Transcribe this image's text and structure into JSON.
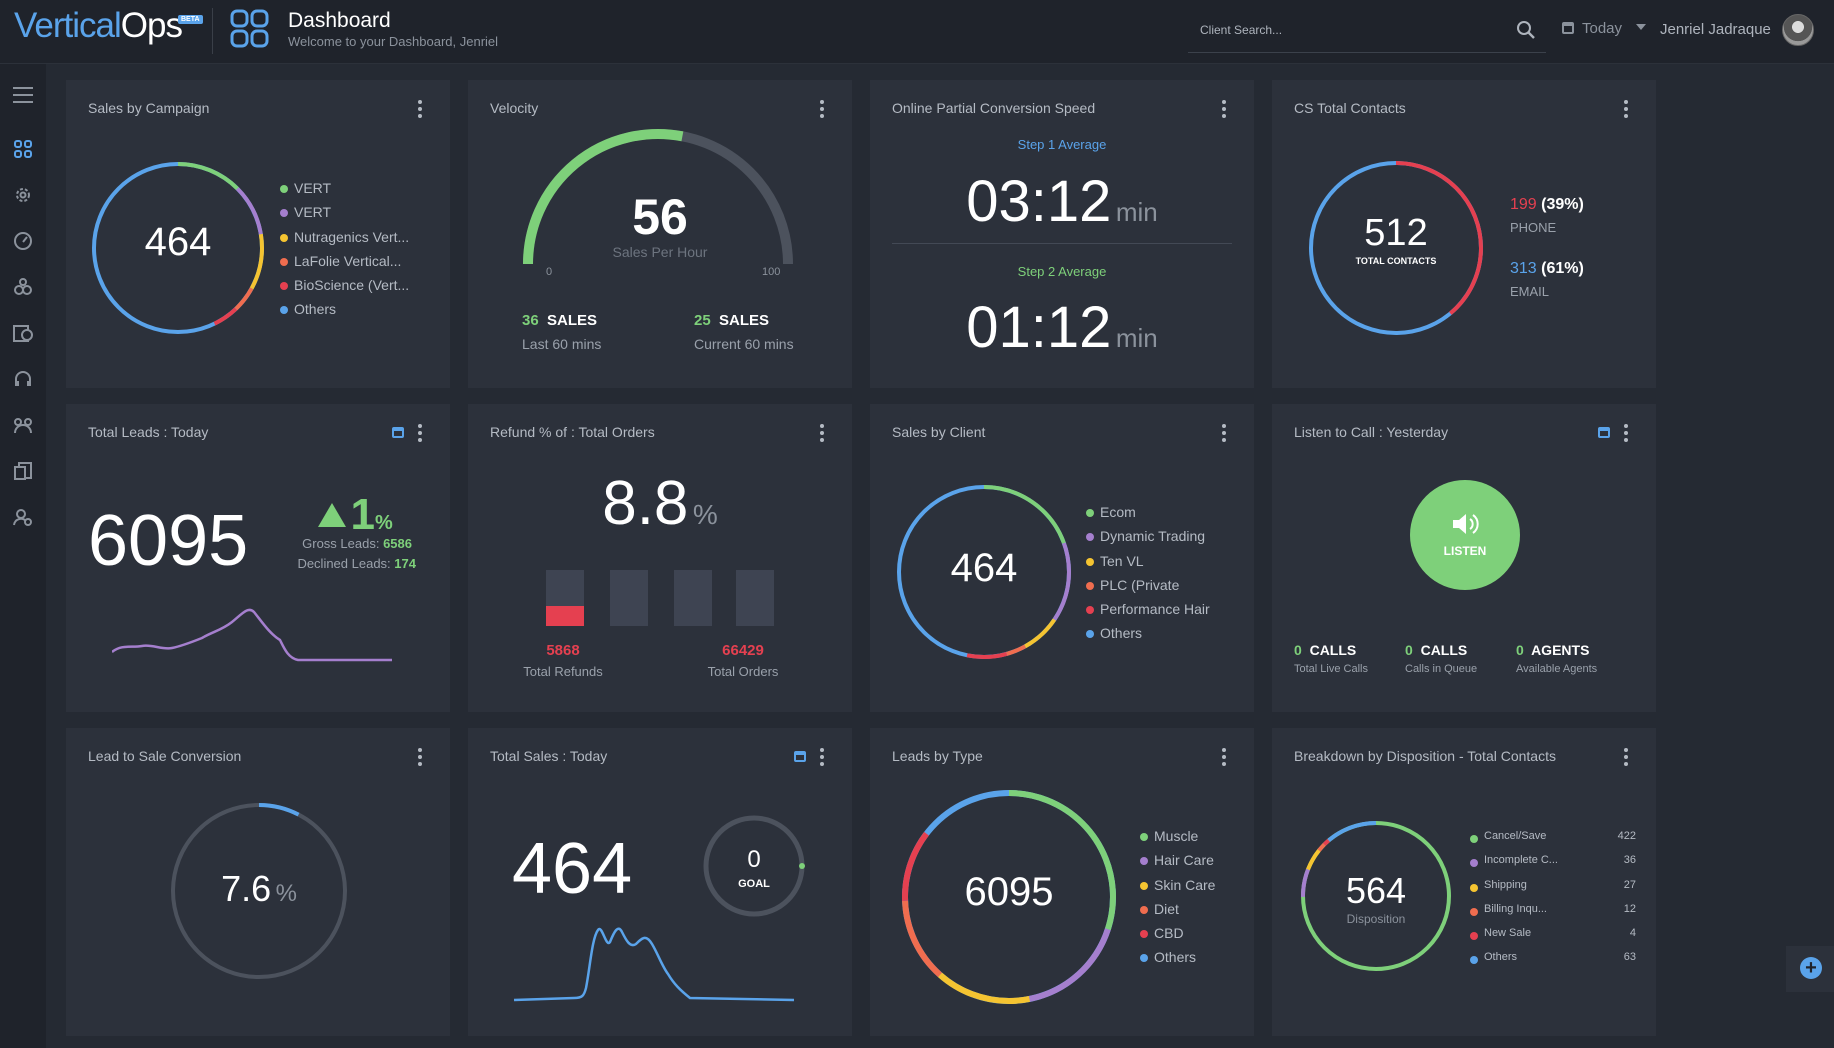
{
  "header": {
    "logo_text_a": "Vertical",
    "logo_text_b": "Ops",
    "beta": "BETA",
    "title": "Dashboard",
    "subtitle": "Welcome to your Dashboard, Jenriel",
    "search_placeholder": "Client Search...",
    "date_label": "Today",
    "user_name": "Jenriel Jadraque"
  },
  "colors": {
    "green": "#7ed07a",
    "blue": "#5aa3ea",
    "red": "#e54050",
    "purple": "#a57fce",
    "yellow": "#f5c431",
    "orange": "#f06d4f",
    "gray": "#4c525d"
  },
  "sidebar": {
    "items": [
      "menu-icon",
      "dashboard-icon",
      "gear-icon",
      "gauge-icon",
      "settings-cluster-icon",
      "dollar-doc-icon",
      "headset-icon",
      "team-icon",
      "documents-icon",
      "user-settings-icon"
    ]
  },
  "cards": {
    "sales_by_campaign": {
      "title": "Sales by Campaign",
      "total": "464",
      "legend": [
        {
          "label": "VERT",
          "color": "#7ed07a"
        },
        {
          "label": "VERT",
          "color": "#a57fce"
        },
        {
          "label": "Nutragenics Vert...",
          "color": "#f5c431"
        },
        {
          "label": "LaFolie Vertical...",
          "color": "#f06d4f"
        },
        {
          "label": "BioScience (Vert...",
          "color": "#e54050"
        },
        {
          "label": "Others",
          "color": "#5aa3ea"
        }
      ]
    },
    "velocity": {
      "title": "Velocity",
      "value": "56",
      "value_label": "Sales Per Hour",
      "min": "0",
      "max": "100",
      "gauge_fraction": 0.56,
      "left_num": "36",
      "left_unit": "SALES",
      "left_label": "Last 60 mins",
      "right_num": "25",
      "right_unit": "SALES",
      "right_label": "Current 60 mins"
    },
    "conversion_speed": {
      "title": "Online Partial Conversion Speed",
      "step1_label": "Step 1 Average",
      "step1_value": "03:12",
      "step1_unit": "min",
      "step2_label": "Step 2 Average",
      "step2_value": "01:12",
      "step2_unit": "min"
    },
    "cs_total_contacts": {
      "title": "CS Total Contacts",
      "total": "512",
      "total_label": "TOTAL CONTACTS",
      "phone_num": "199",
      "phone_pct": "(39%)",
      "phone_label": "PHONE",
      "email_num": "313",
      "email_pct": "(61%)",
      "email_label": "EMAIL"
    },
    "total_leads": {
      "title": "Total Leads : Today",
      "value": "6095",
      "change": "1",
      "change_unit": "%",
      "gross_label": "Gross Leads:",
      "gross_value": "6586",
      "declined_label": "Declined Leads:",
      "declined_value": "174"
    },
    "refund": {
      "title": "Refund % of : Total Orders",
      "value": "8.8",
      "unit": "%",
      "refunds_num": "5868",
      "refunds_label": "Total Refunds",
      "orders_num": "66429",
      "orders_label": "Total Orders"
    },
    "sales_by_client": {
      "title": "Sales by Client",
      "total": "464",
      "legend": [
        {
          "label": "Ecom",
          "color": "#7ed07a"
        },
        {
          "label": "Dynamic Trading",
          "color": "#a57fce"
        },
        {
          "label": "Ten VL",
          "color": "#f5c431"
        },
        {
          "label": "PLC (Private",
          "color": "#f06d4f"
        },
        {
          "label": "Performance Hair",
          "color": "#e54050"
        },
        {
          "label": "Others",
          "color": "#5aa3ea"
        }
      ]
    },
    "listen_to_call": {
      "title": "Listen to Call : Yesterday",
      "button_label": "LISTEN",
      "stats": [
        {
          "num": "0",
          "unit": "CALLS",
          "label": "Total Live Calls"
        },
        {
          "num": "0",
          "unit": "CALLS",
          "label": "Calls in Queue"
        },
        {
          "num": "0",
          "unit": "AGENTS",
          "label": "Available Agents"
        }
      ]
    },
    "lead_to_sale": {
      "title": "Lead to Sale Conversion",
      "value": "7.6",
      "unit": "%",
      "fraction": 0.076
    },
    "total_sales": {
      "title": "Total Sales : Today",
      "value": "464",
      "goal_num": "0",
      "goal_label": "GOAL"
    },
    "leads_by_type": {
      "title": "Leads by Type",
      "total": "6095",
      "legend": [
        {
          "label": "Muscle",
          "color": "#7ed07a"
        },
        {
          "label": "Hair Care",
          "color": "#a57fce"
        },
        {
          "label": "Skin Care",
          "color": "#f5c431"
        },
        {
          "label": "Diet",
          "color": "#f06d4f"
        },
        {
          "label": "CBD",
          "color": "#e54050"
        },
        {
          "label": "Others",
          "color": "#5aa3ea"
        }
      ]
    },
    "disposition": {
      "title": "Breakdown by Disposition - Total Contacts",
      "total": "564",
      "total_label": "Disposition",
      "legend": [
        {
          "label": "Cancel/Save",
          "value": "422",
          "color": "#7ed07a"
        },
        {
          "label": "Incomplete C...",
          "value": "36",
          "color": "#a57fce"
        },
        {
          "label": "Shipping",
          "value": "27",
          "color": "#f5c431"
        },
        {
          "label": "Billing Inqu...",
          "value": "12",
          "color": "#f06d4f"
        },
        {
          "label": "New Sale",
          "value": "4",
          "color": "#e54050"
        },
        {
          "label": "Others",
          "value": "63",
          "color": "#5aa3ea"
        }
      ]
    }
  }
}
